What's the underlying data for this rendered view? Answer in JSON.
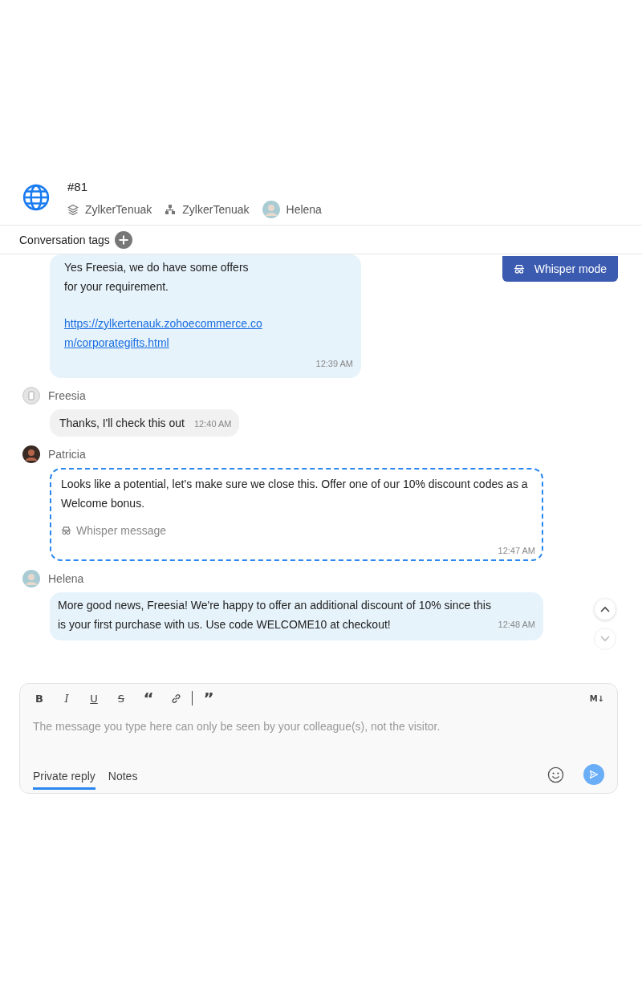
{
  "header": {
    "title": "#81",
    "meta": [
      {
        "kind": "brand",
        "text": "ZylkerTenuak"
      },
      {
        "kind": "department",
        "text": "ZylkerTenuak"
      },
      {
        "kind": "agent",
        "text": "Helena"
      }
    ]
  },
  "tags_bar": {
    "label": "Conversation tags"
  },
  "whisper_mode": {
    "label": "Whisper mode"
  },
  "messages": [
    {
      "kind": "agent",
      "text": "Yes Freesia, we do have some offers\nfor your requirement.",
      "link": "https://zylkertenauk.zohoecommerce.com/corporategifts.html",
      "time": "12:39 AM"
    },
    {
      "kind": "visitor",
      "sender": "Freesia",
      "text": "Thanks, I'll check this out",
      "time": "12:40 AM"
    },
    {
      "kind": "whisper",
      "sender": "Patricia",
      "text": "Looks like a potential, let’s make sure we close this. Offer one of our 10% discount codes as a Welcome bonus.",
      "note": "Whisper message",
      "time": "12:47 AM"
    },
    {
      "kind": "agent",
      "sender": "Helena",
      "text": "More good news, Freesia! We're happy to offer an additional discount of 10% since this is your first purchase with us. Use code WELCOME10 at checkout!",
      "time": "12:48 AM"
    }
  ],
  "composer": {
    "toolbar": [
      {
        "kind": "bold",
        "label": "B"
      },
      {
        "kind": "italic",
        "label": "I"
      },
      {
        "kind": "underline",
        "label": "U"
      },
      {
        "kind": "strike",
        "label": "S"
      },
      {
        "kind": "quote",
        "label": "“"
      },
      {
        "kind": "link"
      },
      {
        "kind": "divider"
      },
      {
        "kind": "quote",
        "label": "”"
      }
    ],
    "markdown": "M↓",
    "placeholder": "The message you type here can only be seen by your colleague(s), not the visitor.",
    "tabs": [
      {
        "label": "Private reply",
        "selected": true
      },
      {
        "label": "Notes",
        "selected": false
      }
    ]
  }
}
